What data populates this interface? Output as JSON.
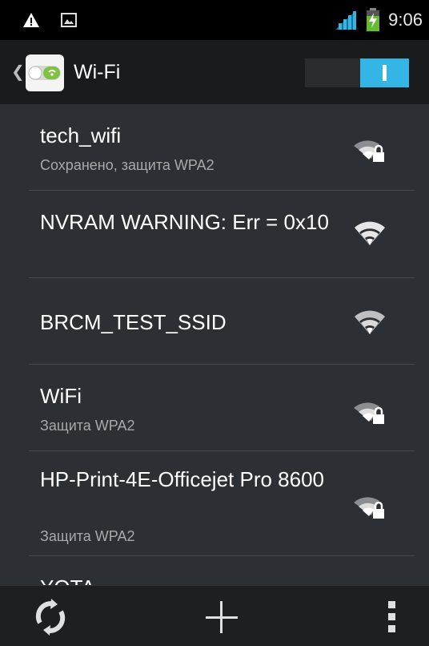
{
  "status_bar": {
    "time": "9:06",
    "icons": [
      "warning-icon",
      "image-icon",
      "signal-bars-icon",
      "battery-charging-icon"
    ],
    "accent_signal_color": "#33b5e5",
    "battery_color": "#66bb33"
  },
  "action_bar": {
    "title": "Wi-Fi",
    "up_icon": "chevron-left-icon",
    "app_icon": "wifi-settings-icon",
    "switch_on": true,
    "switch_color": "#33b5e5"
  },
  "networks": [
    {
      "ssid": "tech_wifi",
      "status": "Сохранено, защита WPA2",
      "secured": true
    },
    {
      "ssid": "NVRAM WARNING: Err = 0x10",
      "status": "",
      "secured": false
    },
    {
      "ssid": "BRCM_TEST_SSID",
      "status": "",
      "secured": false
    },
    {
      "ssid": "WiFi",
      "status": "Защита WPA2",
      "secured": true
    },
    {
      "ssid": "HP-Print-4E-Officejet Pro 8600",
      "status": "Защита WPA2",
      "secured": true
    },
    {
      "ssid": "YOTA",
      "status": "",
      "secured": false
    }
  ],
  "bottom_bar": {
    "buttons": [
      "scan-refresh-icon",
      "add-network-icon",
      "overflow-menu-icon"
    ]
  }
}
